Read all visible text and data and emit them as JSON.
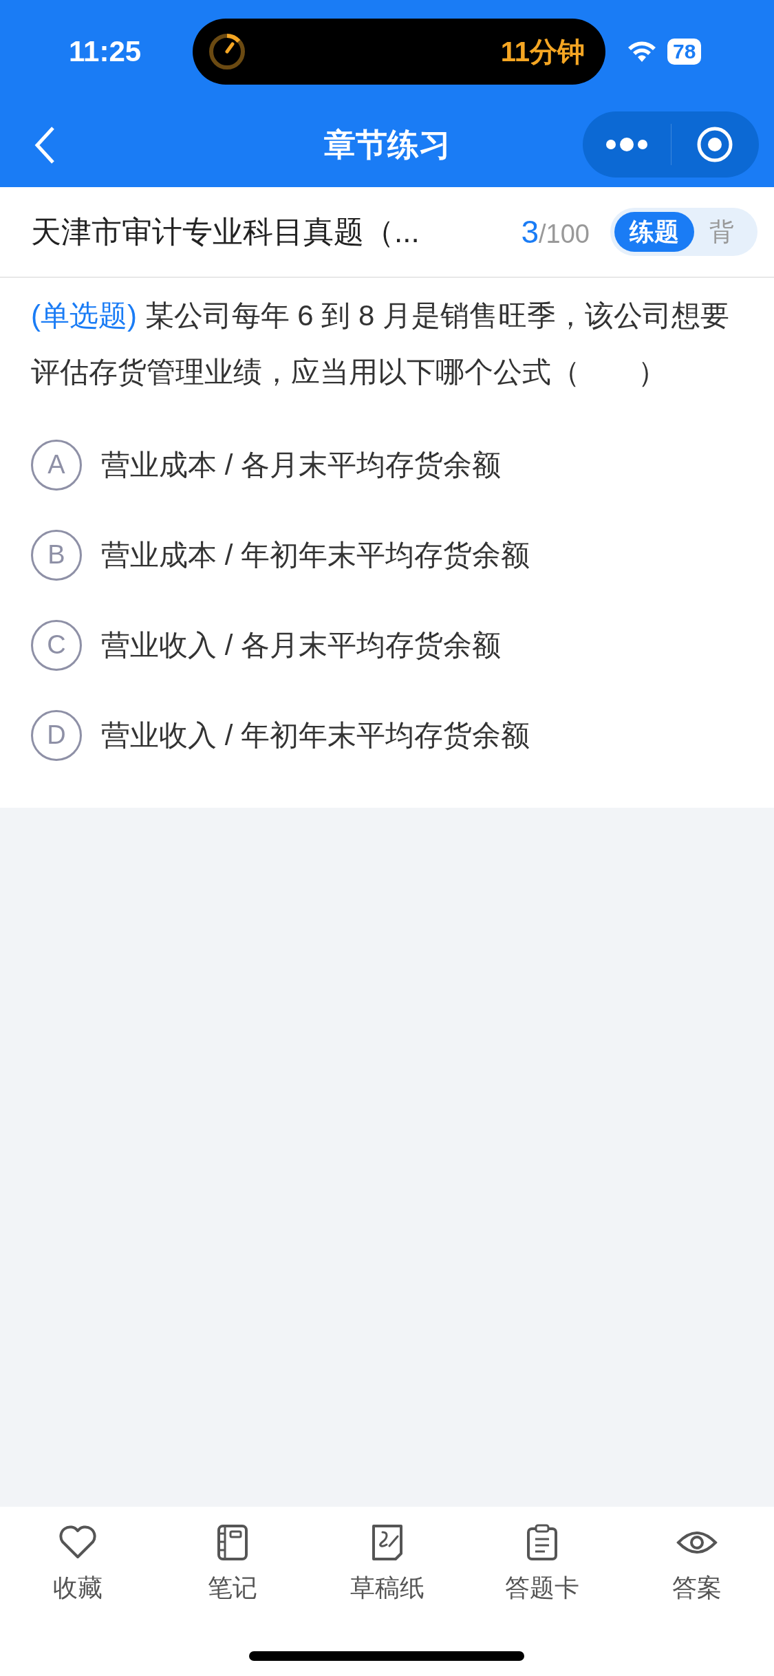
{
  "status_bar": {
    "time": "11:25",
    "timer": "11分钟",
    "battery": "78"
  },
  "nav": {
    "title": "章节练习"
  },
  "header": {
    "title": "天津市审计专业科目真题（...",
    "current": "3",
    "total": "/100",
    "mode_tabs": [
      {
        "label": "练题",
        "selected": true
      },
      {
        "label": "背",
        "selected": false
      }
    ]
  },
  "question": {
    "type": "(单选题)",
    "text": "某公司每年 6 到 8 月是销售旺季，该公司想要评估存货管理业绩，应当用以下哪个公式（　　）",
    "options": [
      {
        "letter": "A",
        "text": "营业成本 / 各月末平均存货余额"
      },
      {
        "letter": "B",
        "text": "营业成本 / 年初年末平均存货余额"
      },
      {
        "letter": "C",
        "text": "营业收入 / 各月末平均存货余额"
      },
      {
        "letter": "D",
        "text": "营业收入 / 年初年末平均存货余额"
      }
    ]
  },
  "toolbar": [
    {
      "kind": "favorite",
      "label": "收藏"
    },
    {
      "kind": "notes",
      "label": "笔记"
    },
    {
      "kind": "draft",
      "label": "草稿纸"
    },
    {
      "kind": "answer_card",
      "label": "答题卡"
    },
    {
      "kind": "answer",
      "label": "答案"
    }
  ]
}
